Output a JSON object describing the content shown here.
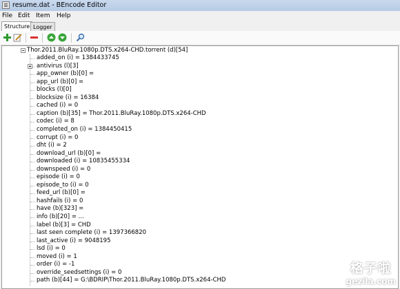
{
  "window": {
    "title": "resume.dat - BEncode Editor"
  },
  "menu": [
    "File",
    "Edit",
    "Item",
    "Help"
  ],
  "tabs": [
    "Structure",
    "Logger"
  ],
  "toolbar": {
    "icons": [
      "add-icon",
      "edit-icon",
      "remove-icon",
      "move-up-icon",
      "move-down-icon",
      "search-icon"
    ],
    "colors": {
      "add": "#2e9b2e",
      "remove": "#d93030",
      "move": "#3aa53a"
    }
  },
  "tree": {
    "root": "Thor.2011.BluRay.1080p.DTS.x264-CHD.torrent (d)[54]",
    "items": [
      "added_on (i) = 1384433745",
      "antivirus (l)[3]",
      "app_owner (b)[0] =",
      "app_url (b)[0] =",
      "blocks (l)[0]",
      "blocksize (i) = 16384",
      "cached (i) = 0",
      "caption (b)[35] = Thor.2011.BluRay.1080p.DTS.x264-CHD",
      "codec (i) = 8",
      "completed_on (i) = 1384450415",
      "corrupt (i) = 0",
      "dht (i) = 2",
      "download_url (b)[0] =",
      "downloaded (i) = 10835455334",
      "downspeed (i) = 0",
      "episode (i) = 0",
      "episode_to (i) = 0",
      "feed_url (b)[0] =",
      "hashfails (i) = 0",
      "have (b)[323] =",
      "info (b)[20] = ...",
      "label (b)[3] = CHD",
      "last seen complete (i) = 1397366820",
      "last_active (i) = 9048195",
      "lsd (i) = 0",
      "moved (i) = 1",
      "order (i) = -1",
      "override_seedsettings (i) = 0",
      "path (b)[44] = G:\\BDRIP\\Thor.2011.BluRay.1080p.DTS.x264-CHD"
    ]
  },
  "watermark": {
    "line1": "格子啦",
    "line2": "gezila.com"
  }
}
